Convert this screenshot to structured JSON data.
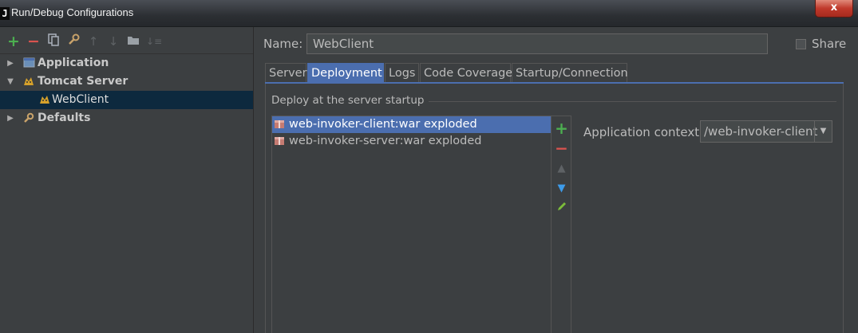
{
  "window": {
    "title": "Run/Debug Configurations",
    "app_icon_letter": "J",
    "close_glyph": "x"
  },
  "toolbar": {
    "icons": [
      "add-icon",
      "remove-icon",
      "copy-icon",
      "wrench-icon",
      "move-up-icon",
      "move-down-icon",
      "folder-icon",
      "sort-icon"
    ]
  },
  "tree": {
    "items": [
      {
        "label": "Application",
        "expanded": false,
        "bold": true,
        "icon": "application-icon"
      },
      {
        "label": "Tomcat Server",
        "expanded": true,
        "bold": true,
        "icon": "tomcat-icon"
      },
      {
        "label": "WebClient",
        "selected": true,
        "bold": false,
        "icon": "tomcat-icon"
      },
      {
        "label": "Defaults",
        "expanded": false,
        "bold": true,
        "icon": "wrench-icon"
      }
    ]
  },
  "form": {
    "name_label": "Name:",
    "name_value": "WebClient",
    "share_label": "Share",
    "share_checked": false
  },
  "tabs": [
    {
      "label": "Server",
      "active": false
    },
    {
      "label": "Deployment",
      "active": true
    },
    {
      "label": "Logs",
      "active": false
    },
    {
      "label": "Code Coverage",
      "active": false
    },
    {
      "label": "Startup/Connection",
      "active": false
    }
  ],
  "deployment": {
    "group_title": "Deploy at the server startup",
    "artifacts": [
      {
        "label": "web-invoker-client:war exploded",
        "selected": true
      },
      {
        "label": "web-invoker-server:war exploded",
        "selected": false
      }
    ],
    "context_label": "Application context:",
    "context_value": "/web-invoker-client"
  },
  "colors": {
    "accent": "#4b6eaf",
    "background": "#3c3f41",
    "tree_selection": "#0d293e",
    "add": "#4caf50",
    "remove": "#d9534f"
  }
}
